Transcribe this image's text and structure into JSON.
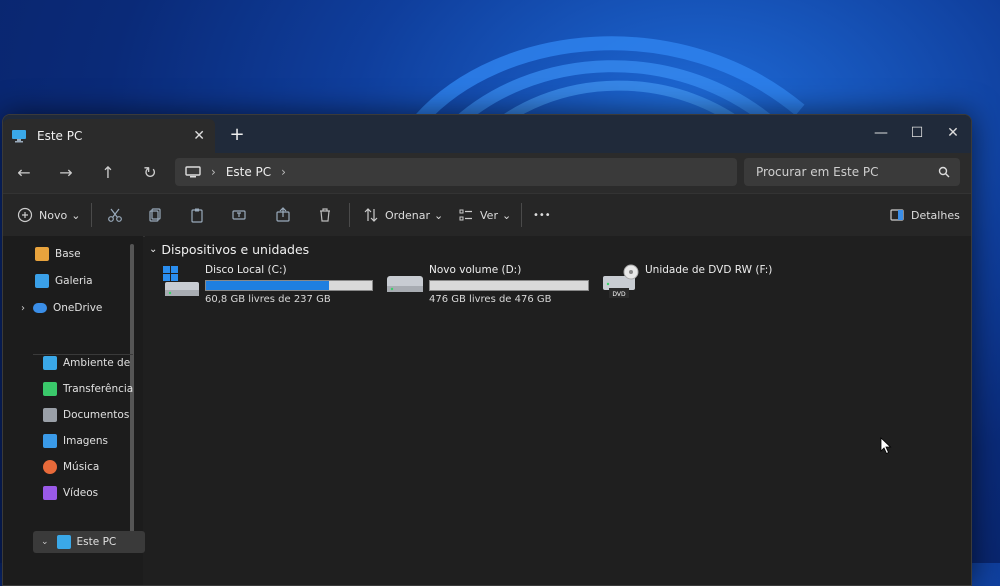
{
  "tab": {
    "title": "Este PC",
    "close": "✕",
    "new": "+"
  },
  "window_controls": {
    "minimize": "—",
    "maximize": "☐",
    "close": "✕"
  },
  "nav": {
    "back": "←",
    "forward": "→",
    "up": "↑",
    "refresh": "↻"
  },
  "address": {
    "segment": "Este PC",
    "sep1": "›",
    "sep2": "›"
  },
  "search": {
    "placeholder": "Procurar em Este PC"
  },
  "toolbar": {
    "new_label": "Novo",
    "sort_label": "Ordenar",
    "view_label": "Ver",
    "more_label": "•••",
    "details_label": "Detalhes",
    "chevron": "⌄"
  },
  "sidebar": {
    "items": [
      {
        "label": "Base",
        "color": "#e8a33d"
      },
      {
        "label": "Galeria",
        "color": "#3aa0e8"
      },
      {
        "label": "OneDrive",
        "color": "#3a8ee8"
      },
      {
        "label": "Ambiente de",
        "color": "#3aa8e8",
        "pinned": true
      },
      {
        "label": "Transferência",
        "color": "#3ac86a",
        "pinned": true
      },
      {
        "label": "Documentos",
        "color": "#9aa0a8",
        "pinned": true
      },
      {
        "label": "Imagens",
        "color": "#3a9ae8",
        "pinned": true
      },
      {
        "label": "Música",
        "color": "#e86a3a",
        "pinned": true
      },
      {
        "label": "Vídeos",
        "color": "#9a5ae8",
        "pinned": true
      },
      {
        "label": "Este PC",
        "color": "#3aa8e8"
      }
    ],
    "pin_glyph": "📌"
  },
  "content": {
    "group_title": "Dispositivos e unidades",
    "drives": [
      {
        "name": "Disco Local (C:)",
        "free_text": "60,8 GB livres de 237 GB",
        "used_fraction": 0.74
      },
      {
        "name": "Novo volume (D:)",
        "free_text": "476 GB livres de 476 GB",
        "used_fraction": 0.0
      },
      {
        "name": "Unidade de DVD RW (F:)",
        "label": "DVD"
      }
    ]
  },
  "colors": {
    "accent": "#1f7fe0",
    "window_bg": "#1f1f1f"
  }
}
